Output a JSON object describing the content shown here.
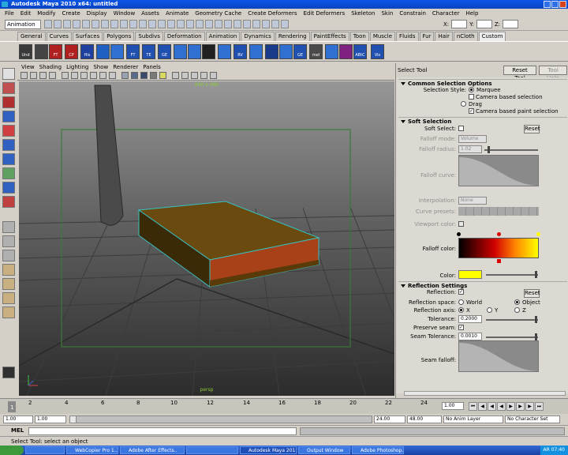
{
  "window": {
    "title": "Autodesk Maya 2010 x64: untitled"
  },
  "menus": [
    "File",
    "Edit",
    "Modify",
    "Create",
    "Display",
    "Window",
    "Assets",
    "Animate",
    "Geometry Cache",
    "Create Deformers",
    "Edit Deformers",
    "Skeleton",
    "Skin",
    "Constrain",
    "Character",
    "Help"
  ],
  "status_line": {
    "mode": "Animation",
    "x_label": "X:",
    "y_label": "Y:",
    "z_label": "Z:"
  },
  "shelf_tabs": [
    "General",
    "Curves",
    "Surfaces",
    "Polygons",
    "Subdivs",
    "Deformation",
    "Animation",
    "Dynamics",
    "Rendering",
    "PaintEffects",
    "Toon",
    "Muscle",
    "Fluids",
    "Fur",
    "Hair",
    "nCloth",
    "Custom"
  ],
  "shelf_icon_labels": [
    "Und",
    "FT",
    "CP",
    "His",
    "FT",
    "TE",
    "GE",
    "RV",
    "GE",
    "mel",
    "ABtC",
    "Vis"
  ],
  "panel_menus": [
    "View",
    "Shading",
    "Lighting",
    "Show",
    "Renderer",
    "Panels"
  ],
  "viewport": {
    "resolution_gate": "640 x 480",
    "camera": "persp"
  },
  "tool_settings": {
    "title": "Select Tool",
    "reset_tool": "Reset Tool",
    "tool_help": "Tool Help",
    "sections": {
      "common": "Common Selection Options",
      "soft": "Soft Selection",
      "reflection": "Reflection Settings"
    },
    "common": {
      "selection_style_label": "Selection Style:",
      "marquee": "Marquee",
      "camera_based_selection": "Camera based selection",
      "drag": "Drag",
      "camera_based_paint_selection": "Camera based paint selection"
    },
    "soft": {
      "soft_select_label": "Soft Select:",
      "reset": "Reset",
      "falloff_mode_label": "Falloff mode:",
      "falloff_mode_value": "Volume",
      "falloff_radius_label": "Falloff radius:",
      "falloff_radius_value": "1.02",
      "falloff_curve_label": "Falloff curve:",
      "interpolation_label": "Interpolation:",
      "interpolation_value": "None",
      "curve_presets_label": "Curve presets:",
      "viewport_color_label": "Viewport color:",
      "falloff_color_label": "Falloff color:",
      "color_label": "Color:",
      "color_swatch": "#ffff00"
    },
    "reflection": {
      "reflection_label": "Reflection:",
      "reset": "Reset",
      "space_label": "Reflection space:",
      "space_world": "World",
      "space_object": "Object",
      "axis_label": "Reflection axis:",
      "axis_x": "X",
      "axis_y": "Y",
      "axis_z": "Z",
      "tolerance_label": "Tolerance:",
      "tolerance_value": "0.2000",
      "preserve_seam_label": "Preserve seam:",
      "seam_tolerance_label": "Seam Tolerance:",
      "seam_tolerance_value": "0.0010",
      "seam_falloff_label": "Seam falloff:"
    }
  },
  "time_slider": {
    "ticks": [
      "2",
      "4",
      "6",
      "8",
      "10",
      "12",
      "14",
      "16",
      "18",
      "20",
      "22",
      "24"
    ],
    "current_frame": "1",
    "current_time_field": "1.00"
  },
  "range_slider": {
    "start": "1.00",
    "inner_start": "1.00",
    "inner_end": "24.00",
    "end": "48.00",
    "anim_layer": "No Anim Layer",
    "character_set": "No Character Set"
  },
  "command_line": {
    "label": "MEL"
  },
  "help_line": {
    "text": "Select Tool: select an object"
  },
  "taskbar": {
    "items": [
      "",
      "WebCopier Pro 1..",
      "Adobe After Effects..",
      "",
      "Autodesk Maya 201..",
      "Output Window",
      "Adobe Photoshop.."
    ],
    "lang": "AR",
    "clock": "07:40"
  }
}
